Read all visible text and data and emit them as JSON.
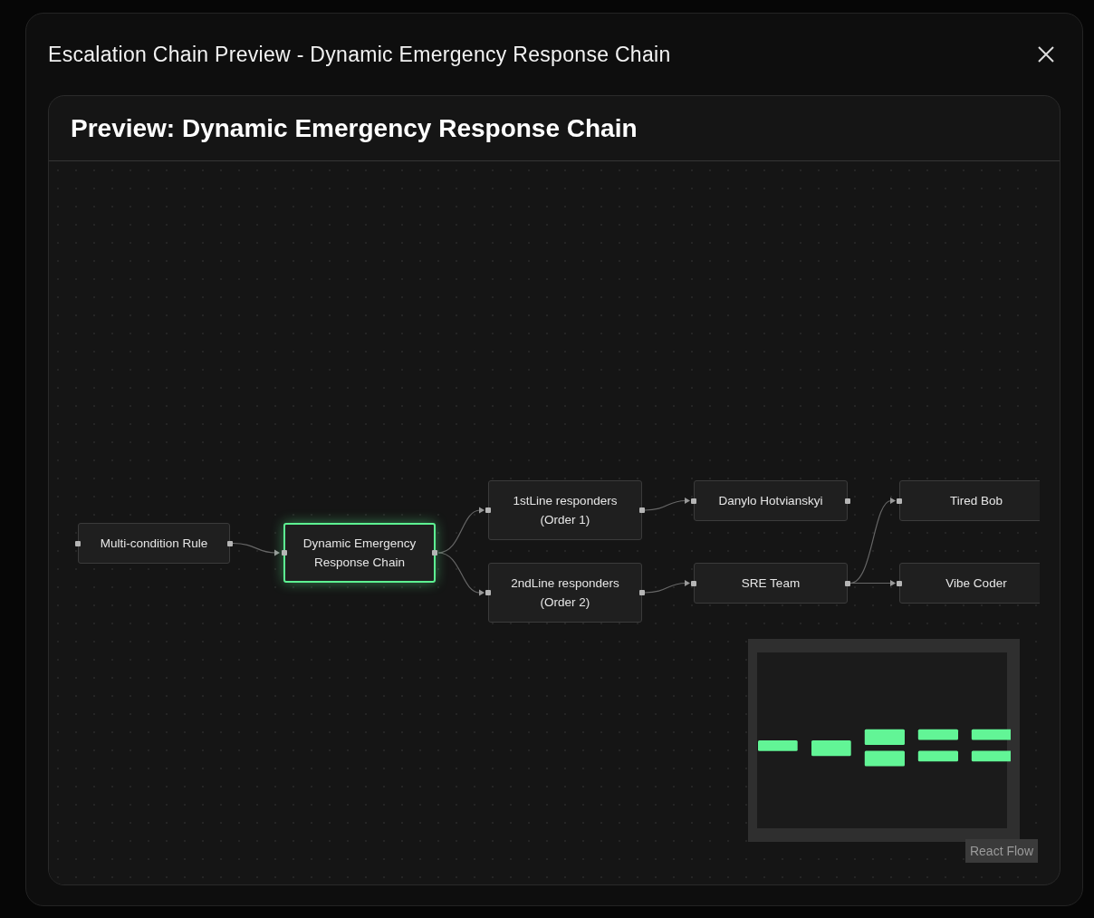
{
  "window": {
    "title": "Escalation Chain Preview - Dynamic Emergency Response Chain"
  },
  "preview": {
    "title": "Preview: Dynamic Emergency Response Chain",
    "flow": {
      "nodes": [
        {
          "label": "Multi-condition Rule",
          "selected": false,
          "children": [
            {
              "label": "Dynamic Emergency Response Chain",
              "selected": true,
              "children": [
                {
                  "label": "1stLine responders (Order 1)",
                  "selected": false,
                  "children": [
                    {
                      "label": "Danylo Hotvianskyi",
                      "selected": false
                    }
                  ]
                },
                {
                  "label": "2ndLine responders (Order 2)",
                  "selected": false,
                  "children": [
                    {
                      "label": "SRE Team",
                      "selected": false,
                      "children": [
                        {
                          "label": "Tired Bob",
                          "selected": false
                        },
                        {
                          "label": "Vibe Coder",
                          "selected": false
                        }
                      ]
                    }
                  ]
                }
              ]
            }
          ]
        }
      ]
    },
    "attribution": "React Flow"
  }
}
